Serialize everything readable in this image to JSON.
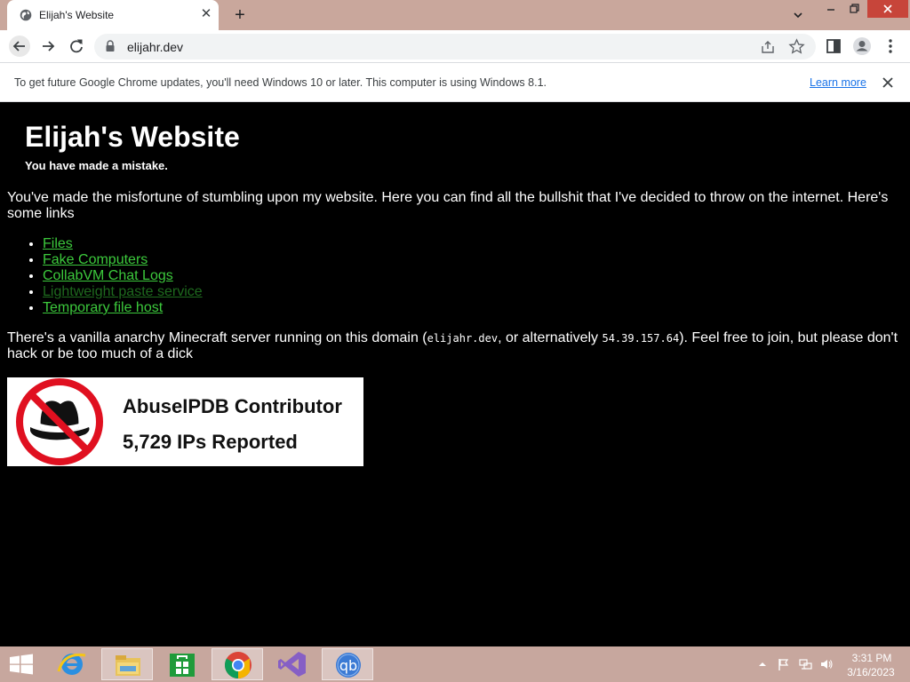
{
  "browser": {
    "tab_title": "Elijah's Website",
    "tab_close_glyph": "✕",
    "new_tab_glyph": "+",
    "url": "elijahr.dev",
    "infobar": {
      "message": "To get future Google Chrome updates, you'll need Windows 10 or later. This computer is using Windows 8.1.",
      "learn_more": "Learn more"
    }
  },
  "page": {
    "title": "Elijah's Website",
    "subtitle": "You have made a mistake.",
    "intro": "You've made the misfortune of stumbling upon my website. Here you can find all the bullshit that I've decided to throw on the internet. Here's some links",
    "links": [
      "Files",
      "Fake Computers",
      "CollabVM Chat Logs",
      "Lightweight paste service",
      "Temporary file host"
    ],
    "minecraft": {
      "before": "There's a vanilla anarchy Minecraft server running on this domain (",
      "domain": "elijahr.dev",
      "middle": ", or alternatively ",
      "ip": "54.39.157.64",
      "after": "). Feel free to join, but please don't hack or be too much of a dick"
    },
    "abuseipdb": {
      "title": "AbuseIPDB Contributor",
      "count": "5,729 IPs Reported"
    }
  },
  "taskbar": {
    "apps": [
      "internet-explorer",
      "file-explorer",
      "store",
      "chrome",
      "visual-studio",
      "qbittorrent"
    ],
    "time": "3:31 PM",
    "date": "3/16/2023"
  },
  "colors": {
    "link": "#3cc93c",
    "link_visited": "#1e6a1e",
    "tabstrip": "#c9a79c",
    "taskbar": "#c7a79e"
  }
}
